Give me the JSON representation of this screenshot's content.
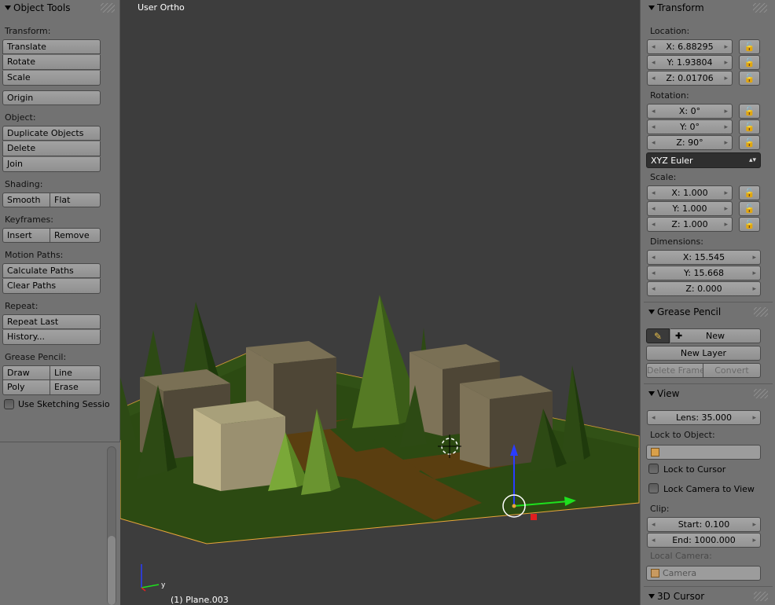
{
  "left_panel": {
    "title": "Object Tools",
    "transform_label": "Transform:",
    "translate": "Translate",
    "rotate": "Rotate",
    "scale": "Scale",
    "origin": "Origin",
    "object_label": "Object:",
    "duplicate": "Duplicate Objects",
    "delete": "Delete",
    "join": "Join",
    "shading_label": "Shading:",
    "smooth": "Smooth",
    "flat": "Flat",
    "keyframes_label": "Keyframes:",
    "insert": "Insert",
    "remove": "Remove",
    "motion_label": "Motion Paths:",
    "calc_paths": "Calculate Paths",
    "clear_paths": "Clear Paths",
    "repeat_label": "Repeat:",
    "repeat_last": "Repeat Last",
    "history": "History...",
    "grease_label": "Grease Pencil:",
    "draw": "Draw",
    "line": "Line",
    "poly": "Poly",
    "erase": "Erase",
    "sketching": "Use Sketching Sessio"
  },
  "viewport": {
    "title": "User Ortho",
    "object": "(1) Plane.003",
    "axis_y": "y"
  },
  "right_panel": {
    "transform_title": "Transform",
    "location_label": "Location:",
    "loc_x": "X: 6.88295",
    "loc_y": "Y: 1.93804",
    "loc_z": "Z: 0.01706",
    "rotation_label": "Rotation:",
    "rot_x": "X: 0°",
    "rot_y": "Y: 0°",
    "rot_z": "Z: 90°",
    "rotation_mode": "XYZ Euler",
    "scale_label": "Scale:",
    "scale_x": "X: 1.000",
    "scale_y": "Y: 1.000",
    "scale_z": "Z: 1.000",
    "dimensions_label": "Dimensions:",
    "dim_x": "X: 15.545",
    "dim_y": "Y: 15.668",
    "dim_z": "Z: 0.000",
    "grease_title": "Grease Pencil",
    "new": "New",
    "new_layer": "New Layer",
    "delete_frame": "Delete Frame",
    "convert": "Convert",
    "view_title": "View",
    "lens": "Lens: 35.000",
    "lock_object_label": "Lock to Object:",
    "lock_cursor": "Lock to Cursor",
    "lock_camera": "Lock Camera to View",
    "clip_label": "Clip:",
    "clip_start": "Start: 0.100",
    "clip_end": "End: 1000.000",
    "local_camera_label": "Local Camera:",
    "camera": "Camera",
    "cursor_title": "3D Cursor"
  }
}
